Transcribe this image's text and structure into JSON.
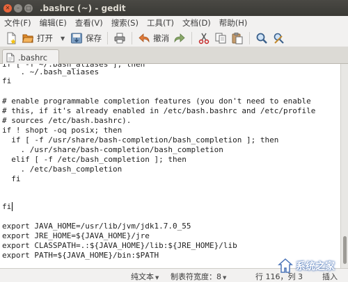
{
  "window": {
    "title": ".bashrc (~) - gedit"
  },
  "menubar": {
    "items": [
      "文件(F)",
      "编辑(E)",
      "查看(V)",
      "搜索(S)",
      "工具(T)",
      "文档(D)",
      "帮助(H)"
    ]
  },
  "toolbar": {
    "open_label": "打开",
    "save_label": "保存",
    "undo_label": "撤消"
  },
  "tab": {
    "label": ".bashrc"
  },
  "editor": {
    "lines": [
      "if [ -f ~/.bash_aliases ]; then",
      "    . ~/.bash_aliases",
      "fi",
      "",
      "# enable programmable completion features (you don't need to enable",
      "# this, if it's already enabled in /etc/bash.bashrc and /etc/profile",
      "# sources /etc/bash.bashrc).",
      "if ! shopt -oq posix; then",
      "  if [ -f /usr/share/bash-completion/bash_completion ]; then",
      "    . /usr/share/bash-completion/bash_completion",
      "  elif [ -f /etc/bash_completion ]; then",
      "    . /etc/bash_completion",
      "  fi",
      "",
      "",
      "fi",
      "",
      "",
      "export JAVA_HOME=/usr/lib/jvm/jdk1.7.0_55",
      "export JRE_HOME=${JAVA_HOME}/jre",
      "export CLASSPATH=.:${JAVA_HOME}/lib:${JRE_HOME}/lib",
      "export PATH=${JAVA_HOME}/bin:$PATH"
    ]
  },
  "statusbar": {
    "language": "纯文本",
    "tab_width": "制表符宽度：8",
    "position": "行 116，列 3",
    "mode": "插入"
  },
  "watermark": {
    "text": "系统之家"
  },
  "colors": {
    "titlebar": "#3c3b37",
    "close_button": "#e9653b",
    "chrome": "#f2f1f0",
    "editor_bg": "#ffffff"
  },
  "icons": [
    "close-icon",
    "minimize-icon",
    "maximize-icon",
    "new-document-icon",
    "open-icon",
    "save-icon",
    "print-icon",
    "undo-icon",
    "redo-icon",
    "cut-icon",
    "copy-icon",
    "paste-icon",
    "search-icon",
    "replace-icon",
    "document-icon"
  ]
}
